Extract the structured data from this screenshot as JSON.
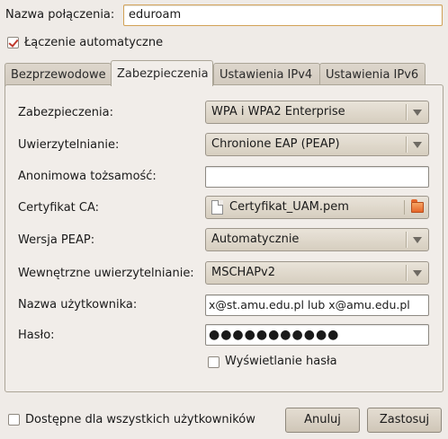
{
  "connection": {
    "name_label": "Nazwa połączenia:",
    "name_value": "eduroam",
    "auto_connect_label": "Łączenie automatyczne",
    "auto_connect_checked": true
  },
  "tabs": [
    {
      "label": "Bezprzewodowe",
      "active": false
    },
    {
      "label": "Zabezpieczenia",
      "active": true
    },
    {
      "label": "Ustawienia IPv4",
      "active": false
    },
    {
      "label": "Ustawienia IPv6",
      "active": false
    }
  ],
  "security": {
    "security_label": "Zabezpieczenia:",
    "security_value": "WPA i WPA2 Enterprise",
    "auth_label": "Uwierzytelnianie:",
    "auth_value": "Chronione EAP (PEAP)",
    "anon_label": "Anonimowa tożsamość:",
    "anon_value": "",
    "ca_label": "Certyfikat CA:",
    "ca_value": "Certyfikat_UAM.pem",
    "peap_label": "Wersja PEAP:",
    "peap_value": "Automatycznie",
    "inner_label": "Wewnętrzne uwierzytelnianie:",
    "inner_value": "MSCHAPv2",
    "user_label": "Nazwa użytkownika:",
    "user_value": "x@st.amu.edu.pl  lub  x@amu.edu.pl",
    "password_label": "Hasło:",
    "password_value": "●●●●●●●●●●●",
    "show_password_label": "Wyświetlanie hasła",
    "show_password_checked": false
  },
  "footer": {
    "all_users_label": "Dostępne dla wszystkich użytkowników",
    "all_users_checked": false,
    "cancel_label": "Anuluj",
    "apply_label": "Zastosuj"
  },
  "colors": {
    "window_bg": "#efebe7",
    "focus_border": "#d2a257",
    "check_mark": "#c0392b"
  }
}
